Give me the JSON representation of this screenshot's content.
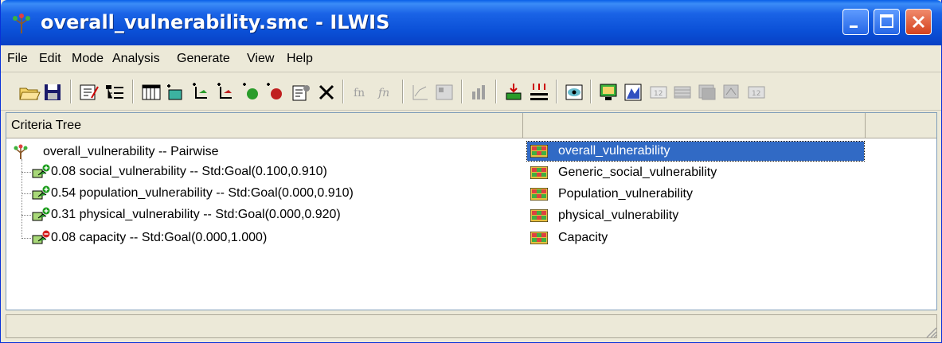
{
  "window": {
    "title": "overall_vulnerability.smc - ILWIS"
  },
  "menu": {
    "items": [
      "File",
      "Edit",
      "Mode",
      "Analysis",
      "Generate",
      "View",
      "Help"
    ]
  },
  "toolbar": {
    "icons": [
      "open-icon",
      "save-icon",
      "edit-mode-icon",
      "tree-mode-icon",
      "table-icon",
      "add-group-icon",
      "add-factor-icon",
      "add-constraint-icon",
      "add-benefit-icon",
      "add-cost-icon",
      "properties-icon",
      "delete-icon",
      "function-icon",
      "function-disabled-icon",
      "chart-icon",
      "map-icon",
      "weights-icon",
      "generate-icon",
      "generate-all-icon",
      "show-icon",
      "display-icon",
      "histogram-icon",
      "value-icon",
      "value-table-icon",
      "maplist-icon",
      "maplist2-icon",
      "number-icon"
    ]
  },
  "tree": {
    "column_header": "Criteria Tree",
    "root": "overall_vulnerability -- Pairwise",
    "children": [
      {
        "label": "0.08 social_vulnerability -- Std:Goal(0.100,0.910)",
        "kind": "benefit"
      },
      {
        "label": "0.54 population_vulnerability -- Std:Goal(0.000,0.910)",
        "kind": "benefit"
      },
      {
        "label": "0.31 physical_vulnerability -- Std:Goal(0.000,0.920)",
        "kind": "benefit"
      },
      {
        "label": "0.08 capacity -- Std:Goal(0.000,1.000)",
        "kind": "cost"
      }
    ]
  },
  "maps": {
    "column_header": "",
    "items": [
      "overall_vulnerability",
      "Generic_social_vulnerability",
      "Population_vulnerability",
      "physical_vulnerability",
      "Capacity"
    ],
    "selected_index": 0
  },
  "colors": {
    "title_bar": "#0a4fd6",
    "selection": "#316ac5",
    "benefit": "#1a9c1a",
    "cost": "#d42020"
  }
}
